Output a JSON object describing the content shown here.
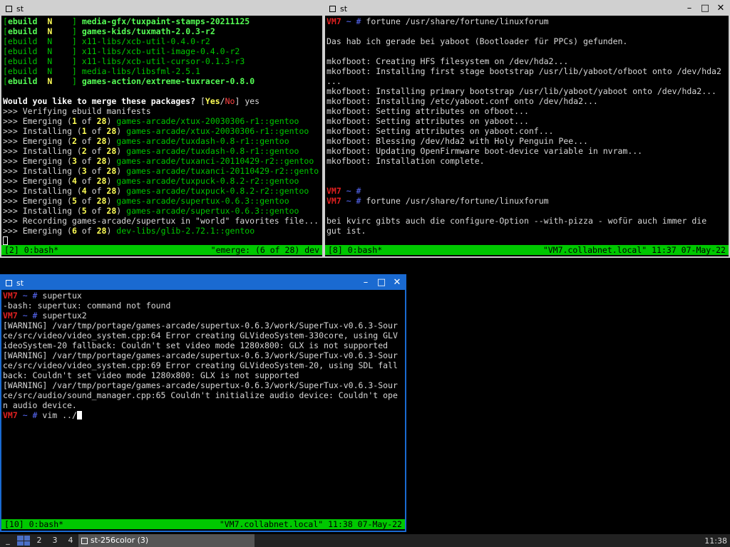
{
  "win1": {
    "title": "st",
    "lines": [
      [
        [
          "g",
          "["
        ],
        [
          "bg",
          "ebuild"
        ],
        [
          "gy",
          "  N    "
        ],
        [
          "g",
          "] "
        ],
        [
          "bg",
          "media-gfx/tuxpaint-stamps-20211125"
        ]
      ],
      [
        [
          "g",
          "["
        ],
        [
          "bg",
          "ebuild"
        ],
        [
          "gy",
          "  N    "
        ],
        [
          "g",
          "] "
        ],
        [
          "bg",
          "games-kids/tuxmath-2.0.3-r2"
        ]
      ],
      [
        [
          "g",
          "[ebuild  N    ] x11-libs/xcb-util-0.4.0-r2"
        ]
      ],
      [
        [
          "g",
          "[ebuild  N    ] x11-libs/xcb-util-image-0.4.0-r2"
        ]
      ],
      [
        [
          "g",
          "[ebuild  N    ] x11-libs/xcb-util-cursor-0.1.3-r3"
        ]
      ],
      [
        [
          "g",
          "[ebuild  N    ] media-libs/libsfml-2.5.1"
        ]
      ],
      [
        [
          "g",
          "["
        ],
        [
          "bg",
          "ebuild"
        ],
        [
          "gy",
          "  N    "
        ],
        [
          "g",
          "] "
        ],
        [
          "bg",
          "games-action/extreme-tuxracer-0.8.0"
        ]
      ],
      [
        [
          "",
          ""
        ]
      ],
      [
        [
          "wb",
          "Would you like to merge these packages? "
        ],
        [
          "",
          "["
        ],
        [
          "gy",
          "Yes"
        ],
        [
          "",
          "/"
        ],
        [
          "rr",
          "No"
        ],
        [
          "",
          "] yes"
        ]
      ],
      [
        [
          "",
          ">>> Verifying ebuild manifests"
        ]
      ],
      [
        [
          "",
          ">>> Emerging ("
        ],
        [
          "gy",
          "1"
        ],
        [
          "",
          " of "
        ],
        [
          "gy",
          "28"
        ],
        [
          "",
          ") "
        ],
        [
          "g",
          "games-arcade/xtux-20030306-r1::gentoo"
        ]
      ],
      [
        [
          "",
          ">>> Installing ("
        ],
        [
          "gy",
          "1"
        ],
        [
          "",
          " of "
        ],
        [
          "gy",
          "28"
        ],
        [
          "",
          ") "
        ],
        [
          "g",
          "games-arcade/xtux-20030306-r1::gentoo"
        ]
      ],
      [
        [
          "",
          ">>> Emerging ("
        ],
        [
          "gy",
          "2"
        ],
        [
          "",
          " of "
        ],
        [
          "gy",
          "28"
        ],
        [
          "",
          ") "
        ],
        [
          "g",
          "games-arcade/tuxdash-0.8-r1::gentoo"
        ]
      ],
      [
        [
          "",
          ">>> Installing ("
        ],
        [
          "gy",
          "2"
        ],
        [
          "",
          " of "
        ],
        [
          "gy",
          "28"
        ],
        [
          "",
          ") "
        ],
        [
          "g",
          "games-arcade/tuxdash-0.8-r1::gentoo"
        ]
      ],
      [
        [
          "",
          ">>> Emerging ("
        ],
        [
          "gy",
          "3"
        ],
        [
          "",
          " of "
        ],
        [
          "gy",
          "28"
        ],
        [
          "",
          ") "
        ],
        [
          "g",
          "games-arcade/tuxanci-20110429-r2::gentoo"
        ]
      ],
      [
        [
          "",
          ">>> Installing ("
        ],
        [
          "gy",
          "3"
        ],
        [
          "",
          " of "
        ],
        [
          "gy",
          "28"
        ],
        [
          "",
          ") "
        ],
        [
          "g",
          "games-arcade/tuxanci-20110429-r2::gento"
        ]
      ],
      [
        [
          "",
          ">>> Emerging ("
        ],
        [
          "gy",
          "4"
        ],
        [
          "",
          " of "
        ],
        [
          "gy",
          "28"
        ],
        [
          "",
          ") "
        ],
        [
          "g",
          "games-arcade/tuxpuck-0.8.2-r2::gentoo"
        ]
      ],
      [
        [
          "",
          ">>> Installing ("
        ],
        [
          "gy",
          "4"
        ],
        [
          "",
          " of "
        ],
        [
          "gy",
          "28"
        ],
        [
          "",
          ") "
        ],
        [
          "g",
          "games-arcade/tuxpuck-0.8.2-r2::gentoo"
        ]
      ],
      [
        [
          "",
          ">>> Emerging ("
        ],
        [
          "gy",
          "5"
        ],
        [
          "",
          " of "
        ],
        [
          "gy",
          "28"
        ],
        [
          "",
          ") "
        ],
        [
          "g",
          "games-arcade/supertux-0.6.3::gentoo"
        ]
      ],
      [
        [
          "",
          ">>> Installing ("
        ],
        [
          "gy",
          "5"
        ],
        [
          "",
          " of "
        ],
        [
          "gy",
          "28"
        ],
        [
          "",
          ") "
        ],
        [
          "g",
          "games-arcade/supertux-0.6.3::gentoo"
        ]
      ],
      [
        [
          "",
          ">>> Recording games-arcade/supertux in \"world\" favorites file..."
        ]
      ],
      [
        [
          "",
          ">>> Emerging ("
        ],
        [
          "gy",
          "6"
        ],
        [
          "",
          " of "
        ],
        [
          "gy",
          "28"
        ],
        [
          "",
          ") "
        ],
        [
          "g",
          "dev-libs/glib-2.72.1::gentoo"
        ]
      ]
    ],
    "status_left": "[2] 0:bash*",
    "status_right": "\"emerge: (6 of 28) dev"
  },
  "win2": {
    "title": "st",
    "lines": [
      [
        [
          "vm",
          "VM7"
        ],
        [
          "b",
          " ~ # "
        ],
        [
          "",
          "fortune /usr/share/fortune/linuxforum"
        ]
      ],
      [
        [
          "",
          ""
        ]
      ],
      [
        [
          "",
          "Das hab ich gerade bei yaboot (Bootloader für PPCs) gefunden."
        ]
      ],
      [
        [
          "",
          ""
        ]
      ],
      [
        [
          "",
          "mkofboot: Creating HFS filesystem on /dev/hda2..."
        ]
      ],
      [
        [
          "",
          "mkofboot: Installing first stage bootstrap /usr/lib/yaboot/ofboot onto /dev/hda2"
        ]
      ],
      [
        [
          "",
          "..."
        ]
      ],
      [
        [
          "",
          "mkofboot: Installing primary bootstrap /usr/lib/yaboot/yaboot onto /dev/hda2..."
        ]
      ],
      [
        [
          "",
          "mkofboot: Installing /etc/yaboot.conf onto /dev/hda2..."
        ]
      ],
      [
        [
          "",
          "mkofboot: Setting attributes on ofboot..."
        ]
      ],
      [
        [
          "",
          "mkofboot: Setting attributes on yaboot..."
        ]
      ],
      [
        [
          "",
          "mkofboot: Setting attributes on yaboot.conf..."
        ]
      ],
      [
        [
          "",
          "mkofboot: Blessing /dev/hda2 with Holy Penguin Pee..."
        ]
      ],
      [
        [
          "",
          "mkofboot: Updating OpenFirmware boot-device variable in nvram..."
        ]
      ],
      [
        [
          "",
          "mkofboot: Installation complete."
        ]
      ],
      [
        [
          "",
          ""
        ]
      ],
      [
        [
          "",
          ""
        ]
      ],
      [
        [
          "vm",
          "VM7"
        ],
        [
          "b",
          " ~ # "
        ]
      ],
      [
        [
          "vm",
          "VM7"
        ],
        [
          "b",
          " ~ # "
        ],
        [
          "",
          "fortune /usr/share/fortune/linuxforum"
        ]
      ],
      [
        [
          "",
          ""
        ]
      ],
      [
        [
          "",
          "bei kvirc gibts auch die configure-Option --with-pizza - wofür auch immer die"
        ]
      ],
      [
        [
          "",
          "gut ist."
        ]
      ],
      [
        [
          "",
          ""
        ]
      ]
    ],
    "prompt_last": [
      [
        "vm",
        "VM7"
      ],
      [
        "b",
        " ~ # "
      ]
    ],
    "status_left": "[8] 0:bash*",
    "status_right": "\"VM7.collabnet.local\" 11:37 07-May-22"
  },
  "win3": {
    "title": "st",
    "lines": [
      [
        [
          "vm",
          "VM7"
        ],
        [
          "b",
          " ~ # "
        ],
        [
          "",
          "supertux"
        ]
      ],
      [
        [
          "",
          "-bash: supertux: command not found"
        ]
      ],
      [
        [
          "vm",
          "VM7"
        ],
        [
          "b",
          " ~ # "
        ],
        [
          "",
          "supertux2"
        ]
      ],
      [
        [
          "",
          "[WARNING] /var/tmp/portage/games-arcade/supertux-0.6.3/work/SuperTux-v0.6.3-Sour"
        ]
      ],
      [
        [
          "",
          "ce/src/video/video_system.cpp:64 Error creating GLVideoSystem-330core, using GLV"
        ]
      ],
      [
        [
          "",
          "ideoSystem-20 fallback: Couldn't set video mode 1280x800: GLX is not supported"
        ]
      ],
      [
        [
          "",
          "[WARNING] /var/tmp/portage/games-arcade/supertux-0.6.3/work/SuperTux-v0.6.3-Sour"
        ]
      ],
      [
        [
          "",
          "ce/src/video/video_system.cpp:69 Error creating GLVideoSystem-20, using SDL fall"
        ]
      ],
      [
        [
          "",
          "back: Couldn't set video mode 1280x800: GLX is not supported"
        ]
      ],
      [
        [
          "",
          "[WARNING] /var/tmp/portage/games-arcade/supertux-0.6.3/work/SuperTux-v0.6.3-Sour"
        ]
      ],
      [
        [
          "",
          "ce/src/audio/sound_manager.cpp:65 Couldn't initialize audio device: Couldn't ope"
        ]
      ],
      [
        [
          "",
          "n audio device."
        ]
      ]
    ],
    "prompt_last": [
      [
        "vm",
        "VM7"
      ],
      [
        "b",
        " ~ # "
      ],
      [
        "",
        "vim ../"
      ]
    ],
    "status_left": "[10] 0:bash*",
    "status_right": "\"VM7.collabnet.local\" 11:38 07-May-22"
  },
  "taskbar": {
    "launcher": "_",
    "workspaces": [
      "2",
      "3",
      "4"
    ],
    "task_label": "st-256color (3)",
    "clock": "11:38"
  }
}
